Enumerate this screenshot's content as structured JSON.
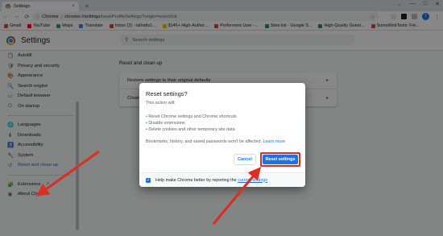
{
  "browser": {
    "tab_title": "Settings",
    "tab_close": "×",
    "new_tab": "+",
    "window_controls": [
      "⌄",
      "—",
      "□",
      "✕"
    ],
    "nav": [
      "←",
      "→",
      "⟳"
    ],
    "omnibox": {
      "chip": "Chrome",
      "separator": "|",
      "url_host": "chrome://settings",
      "url_path": "/resetProfileSettings?origin=userclick"
    },
    "profile_initial": "T",
    "menu": "⋮"
  },
  "bookmarks": [
    {
      "label": "Gmail",
      "color": "#ea4335"
    },
    {
      "label": "YouTube",
      "color": "#ff0000"
    },
    {
      "label": "Maps",
      "color": "#34a853"
    },
    {
      "label": "Translate",
      "color": "#4285f4"
    },
    {
      "label": "Inbox (3) - talhatts1...",
      "color": "#ea4335"
    },
    {
      "label": "$146+ High-Author...",
      "color": "#fbbc04"
    },
    {
      "label": "Performers User -...",
      "color": "#ea4335"
    },
    {
      "label": "Sites list - Google S...",
      "color": "#0f9d58"
    },
    {
      "label": "High-Quality Guest...",
      "color": "#0f9d58"
    },
    {
      "label": "SumoWebTools: Fre...",
      "color": "#ea4335"
    }
  ],
  "settings": {
    "title": "Settings",
    "search_placeholder": "Search settings",
    "sidebar": [
      {
        "label": "Autofill",
        "icon": "📋"
      },
      {
        "label": "Privacy and security",
        "icon": "🛡"
      },
      {
        "label": "Appearance",
        "icon": "🎨"
      },
      {
        "label": "Search engine",
        "icon": "🔍"
      },
      {
        "label": "Default browser",
        "icon": "▭"
      },
      {
        "label": "On startup",
        "icon": "⏻"
      },
      {
        "label": "Languages",
        "icon": "🌐"
      },
      {
        "label": "Downloads",
        "icon": "⬇"
      },
      {
        "label": "Accessibility",
        "icon": "♿"
      },
      {
        "label": "System",
        "icon": "🔧"
      },
      {
        "label": "Reset and clean up",
        "icon": "↺"
      },
      {
        "label": "Extensions",
        "icon": "🧩"
      },
      {
        "label": "About Chrome",
        "icon": "◉"
      }
    ],
    "extensions_external": "↗",
    "section_title": "Reset and clean up",
    "card_rows": [
      {
        "label": "Restore settings to their original defaults",
        "arrow": "▸"
      },
      {
        "label": "Clean up computer",
        "arrow": "▸"
      }
    ]
  },
  "dialog": {
    "title": "Reset settings?",
    "subtitle": "This action will:",
    "items": [
      "• Reset Chrome settings and Chrome shortcuts",
      "• Disable extensions",
      "• Delete cookies and other temporary site data"
    ],
    "note": "Bookmarks, history, and saved passwords won't be affected.",
    "learn_more": "Learn more",
    "cancel_label": "Cancel",
    "reset_label": "Reset settings",
    "footer_text": "Help make Chrome better by reporting the",
    "footer_link": "current settings",
    "checkbox_mark": "✓"
  },
  "colors": {
    "accent": "#1a73e8",
    "highlight_red": "#d93025"
  }
}
